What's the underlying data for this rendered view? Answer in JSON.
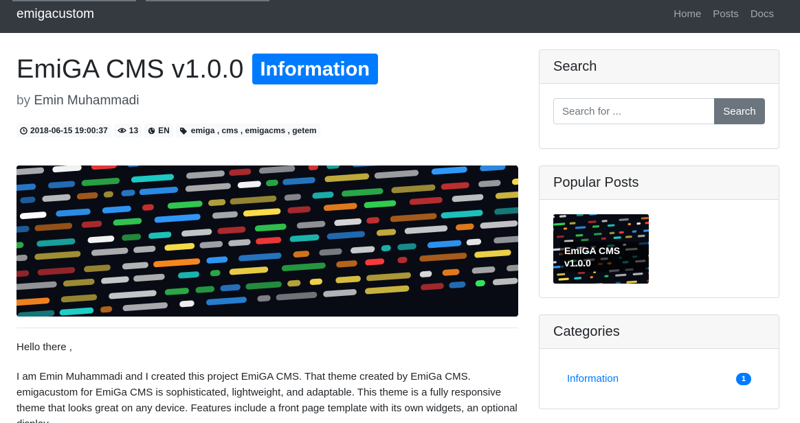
{
  "navbar": {
    "brand": "emigacustom",
    "links": [
      "Home",
      "Posts",
      "Docs"
    ]
  },
  "post": {
    "title": "EmiGA CMS v1.0.0",
    "category_badge": "Information",
    "by_label": "by",
    "author": "Emin Muhammadi",
    "meta": {
      "date": "2018-06-15 19:00:37",
      "views": "13",
      "language": "EN",
      "tags": "emiga , cms , emigacms , getem"
    },
    "greeting": "Hello there ,",
    "body": "I am Emin Muhammadi and I created this project EmiGA CMS. That theme created by EmiGa CMS. emigacustom for EmiGa CMS is sophisticated, lightweight, and adaptable. This theme is a fully responsive theme that looks great on any device. Features include a front page template with its own widgets, an optional display"
  },
  "sidebar": {
    "search": {
      "title": "Search",
      "placeholder": "Search for ...",
      "button": "Search"
    },
    "popular": {
      "title": "Popular Posts",
      "items": [
        {
          "caption": "EmiGA CMS v1.0.0"
        }
      ]
    },
    "categories": {
      "title": "Categories",
      "items": [
        {
          "name": "Information",
          "count": "1"
        }
      ]
    }
  },
  "colors": {
    "navbar_bg": "#343a40",
    "primary": "#007bff",
    "secondary": "#6c757d"
  },
  "icons": {
    "date": "clock-icon",
    "views": "eye-icon",
    "language": "globe-icon",
    "tags": "tags-icon"
  }
}
